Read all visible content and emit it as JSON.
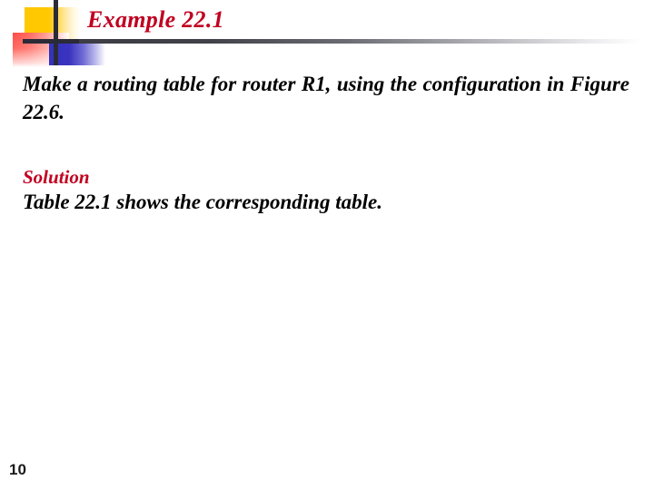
{
  "slide": {
    "title": "Example 22.1",
    "page_number": "10",
    "body": {
      "question": "Make a routing table for router R1, using the configuration in Figure 22.6."
    },
    "solution": {
      "heading": "Solution",
      "text": "Table 22.1 shows the corresponding table."
    },
    "colors": {
      "title_red": "#c00020",
      "accent_yellow": "#ffc800",
      "accent_red": "#ff4d44",
      "accent_blue": "#3333bb",
      "rule_dark": "#3b3b44",
      "body_text": "#000000",
      "background": "#ffffff"
    }
  }
}
